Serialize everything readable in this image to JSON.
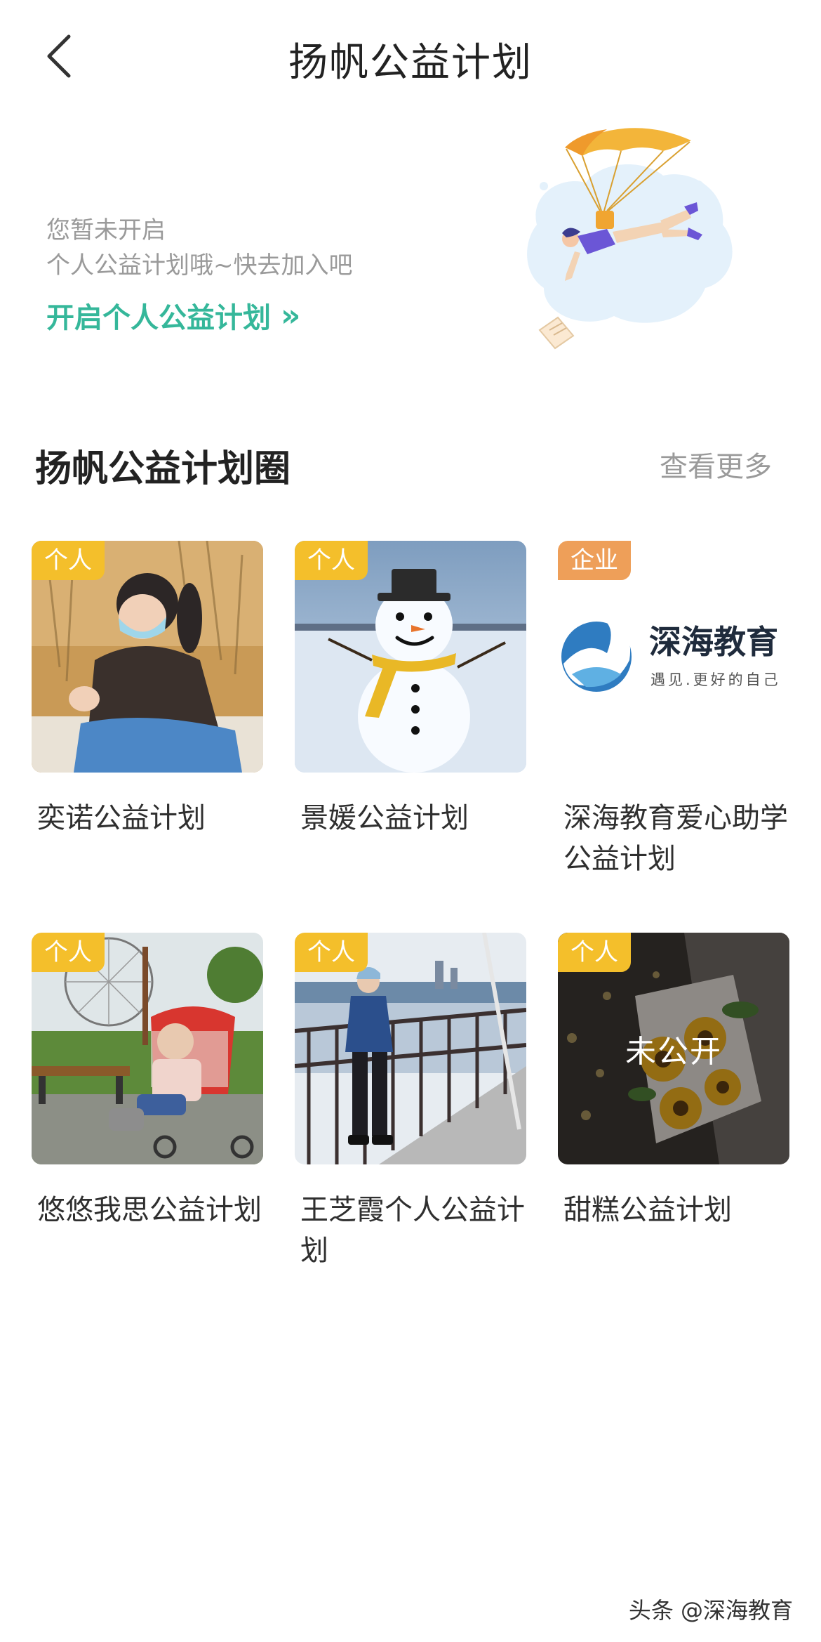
{
  "header": {
    "title": "扬帆公益计划"
  },
  "banner": {
    "line1": "您暂未开启",
    "line2": "个人公益计划哦~快去加入吧",
    "cta_label": "开启个人公益计划",
    "cta_chevron": "»"
  },
  "section": {
    "title": "扬帆公益计划圈",
    "more_label": "查看更多"
  },
  "plans": [
    {
      "badge": "个人",
      "badge_type": "personal",
      "name": "奕诺公益计划"
    },
    {
      "badge": "个人",
      "badge_type": "personal",
      "name": "景媛公益计划"
    },
    {
      "badge": "企业",
      "badge_type": "company",
      "name": "深海教育爱心助学公益计划",
      "logo_title": "深海教育",
      "logo_slogan": "遇见.更好的自己"
    },
    {
      "badge": "个人",
      "badge_type": "personal",
      "name": "悠悠我思公益计划"
    },
    {
      "badge": "个人",
      "badge_type": "personal",
      "name": "王芝霞个人公益计划"
    },
    {
      "badge": "个人",
      "badge_type": "personal",
      "name": "甜糕公益计划",
      "overlay": "未公开"
    }
  ],
  "watermark": "头条 @深海教育",
  "colors": {
    "accent": "#35b79a",
    "personal_badge": "#f4bf2b",
    "company_badge": "#ee9f59"
  }
}
